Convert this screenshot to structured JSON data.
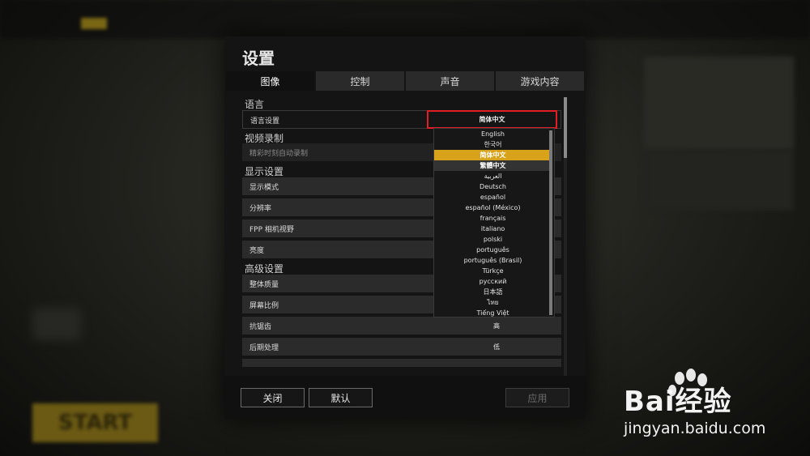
{
  "background": {
    "start_label": "START"
  },
  "dialog": {
    "title": "设置",
    "tabs": [
      {
        "label": "图像",
        "active": true
      },
      {
        "label": "控制",
        "active": false
      },
      {
        "label": "声音",
        "active": false
      },
      {
        "label": "游戏内容",
        "active": false
      }
    ],
    "sections": {
      "language": "语言",
      "video": "视频录制",
      "display": "显示设置",
      "advanced": "高级设置"
    },
    "rows": {
      "language_setting": "语言设置",
      "highlight_record": "精彩时刻自动录制",
      "display_mode": "显示模式",
      "resolution": "分辨率",
      "fpp_fov": "FPP 相机视野",
      "brightness": "亮度",
      "overall_quality": "整体质量",
      "screen_scale": "屏幕比例",
      "anti_aliasing": "抗锯齿",
      "anti_aliasing_value": "高",
      "post_processing": "后期处理",
      "post_processing_value": "低"
    },
    "language_dropdown": {
      "selected": "简体中文",
      "options": [
        "English",
        "한국어",
        "简体中文",
        "繁體中文",
        "العربية",
        "Deutsch",
        "español",
        "español (México)",
        "français",
        "italiano",
        "polski",
        "português",
        "português (Brasil)",
        "Türkçe",
        "русский",
        "日本語",
        "ไทย",
        "Tiếng Việt"
      ]
    },
    "buttons": {
      "close": "关闭",
      "default": "默认",
      "apply": "应用"
    }
  },
  "watermark": {
    "brand": "Bai经验",
    "url": "jingyan.baidu.com"
  },
  "colors": {
    "accent": "#d9a21b",
    "highlight_box": "#e01e24"
  }
}
